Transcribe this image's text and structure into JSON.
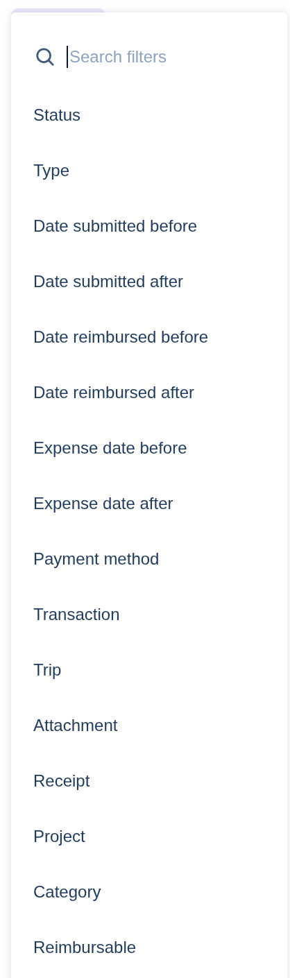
{
  "search": {
    "placeholder": "Search filters"
  },
  "filters": [
    {
      "label": "Status"
    },
    {
      "label": "Type"
    },
    {
      "label": "Date submitted before"
    },
    {
      "label": "Date submitted after"
    },
    {
      "label": "Date reimbursed before"
    },
    {
      "label": "Date reimbursed after"
    },
    {
      "label": "Expense date before"
    },
    {
      "label": "Expense date after"
    },
    {
      "label": "Payment method"
    },
    {
      "label": "Transaction"
    },
    {
      "label": "Trip"
    },
    {
      "label": "Attachment"
    },
    {
      "label": "Receipt"
    },
    {
      "label": "Project"
    },
    {
      "label": "Category"
    },
    {
      "label": "Reimbursable"
    }
  ]
}
